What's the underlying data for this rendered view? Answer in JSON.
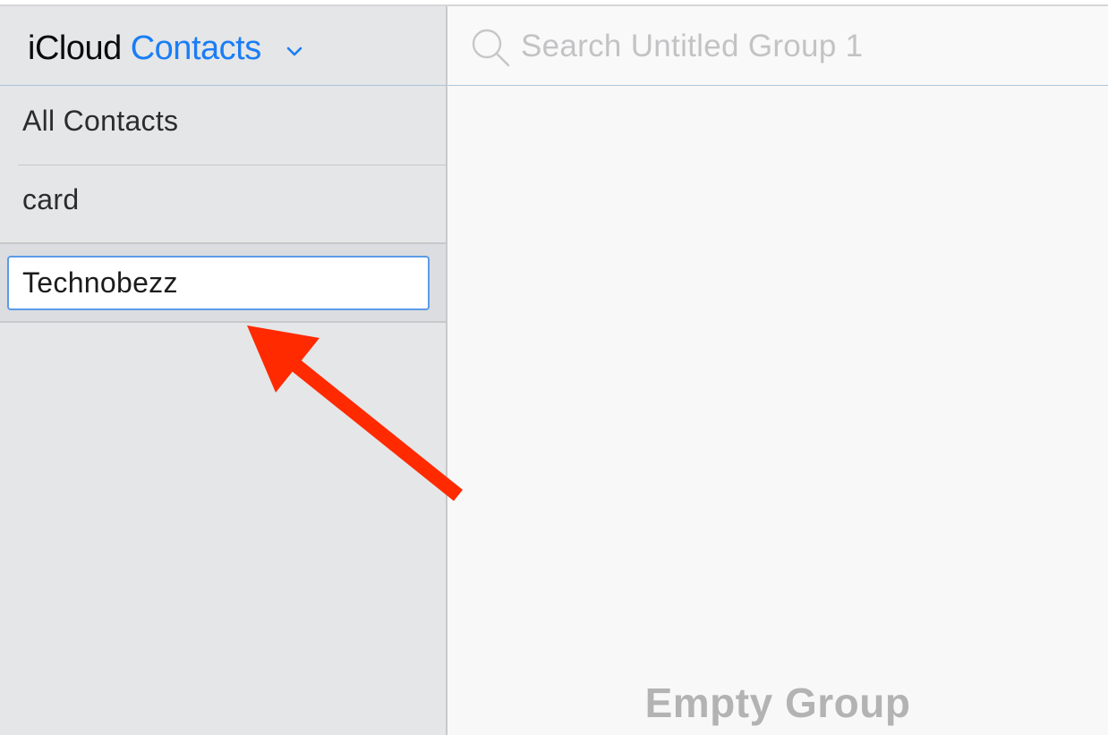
{
  "header": {
    "brand_prefix": "iCloud",
    "brand_app": "Contacts"
  },
  "sidebar": {
    "groups": [
      {
        "label": "All Contacts"
      },
      {
        "label": "card"
      }
    ],
    "editing_group": {
      "value": "Technobezz"
    }
  },
  "search": {
    "placeholder": "Search Untitled Group 1"
  },
  "main": {
    "empty_text": "Empty Group"
  },
  "icons": {
    "brand_menu": "chevron-down-icon",
    "search": "search-icon",
    "annotation": "red-arrow-annotation"
  },
  "colors": {
    "accent": "#1a7df5",
    "sidebar_bg": "#e5e6e8",
    "main_bg": "#f8f8f8",
    "annotation": "#ff2a00",
    "input_focus": "#5b9be8"
  }
}
